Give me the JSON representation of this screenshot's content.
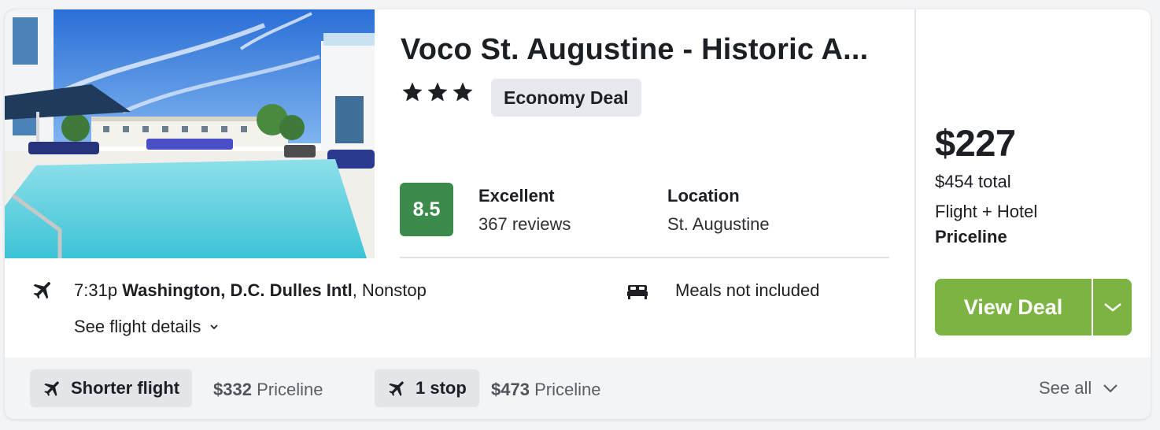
{
  "hotel": {
    "title": "Voco St. Augustine - Historic A...",
    "star_count": 3,
    "badge": "Economy Deal",
    "score": "8.5",
    "rating_label": "Excellent",
    "reviews": "367 reviews",
    "location_label": "Location",
    "location_value": "St. Augustine"
  },
  "flight": {
    "time": "7:31p",
    "airport": "Washington, D.C. Dulles Intl",
    "stops": ", Nonstop",
    "details_link": "See flight details",
    "meals": "Meals not included"
  },
  "price": {
    "per_person": "$227",
    "total": "$454 total",
    "package": "Flight + Hotel",
    "provider": "Priceline",
    "cta": "View Deal"
  },
  "alternatives": [
    {
      "label": "Shorter flight",
      "price": "$332",
      "provider": "Priceline"
    },
    {
      "label": "1 stop",
      "price": "$473",
      "provider": "Priceline"
    }
  ],
  "footer": {
    "see_all": "See all"
  },
  "colors": {
    "score_bg": "#3d8a4d",
    "cta_bg": "#7cb342",
    "badge_bg": "#e7e9ee",
    "footer_bg": "#f3f4f6"
  },
  "icons": {
    "flight": "airplane-icon",
    "bed": "bed-icon",
    "star": "star-icon",
    "chevron": "chevron-down-icon"
  }
}
